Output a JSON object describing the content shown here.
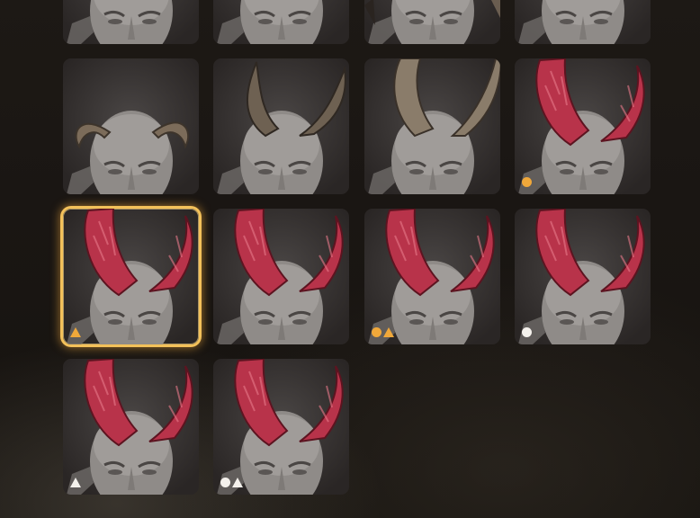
{
  "colors": {
    "selected_border": "#f3c15a",
    "badge_gold": "#f0a83a",
    "badge_white": "#f4f1ec",
    "horn_natural": "#7c6c5a",
    "horn_red": "#b8334a"
  },
  "tiles": [
    {
      "row": 0,
      "col": 0,
      "horn": "cropped",
      "badges": []
    },
    {
      "row": 0,
      "col": 1,
      "horn": "cropped",
      "badges": []
    },
    {
      "row": 0,
      "col": 2,
      "horn": "cropped-dark",
      "badges": []
    },
    {
      "row": 0,
      "col": 3,
      "horn": "cropped",
      "badges": []
    },
    {
      "row": 1,
      "col": 0,
      "horn": "ram-curled",
      "badges": []
    },
    {
      "row": 1,
      "col": 1,
      "horn": "tall-curved",
      "badges": []
    },
    {
      "row": 1,
      "col": 2,
      "horn": "tall-ridged",
      "badges": []
    },
    {
      "row": 1,
      "col": 3,
      "horn": "red-crystal",
      "badges": [
        "dot-gold"
      ]
    },
    {
      "row": 2,
      "col": 0,
      "horn": "red-crystal",
      "badges": [
        "tri-gold"
      ],
      "selected": true
    },
    {
      "row": 2,
      "col": 1,
      "horn": "red-crystal",
      "badges": []
    },
    {
      "row": 2,
      "col": 2,
      "horn": "red-crystal",
      "badges": [
        "dot-gold",
        "tri-gold"
      ]
    },
    {
      "row": 2,
      "col": 3,
      "horn": "red-crystal",
      "badges": [
        "dot-white"
      ]
    },
    {
      "row": 3,
      "col": 0,
      "horn": "red-crystal",
      "badges": [
        "tri-white"
      ]
    },
    {
      "row": 3,
      "col": 1,
      "horn": "red-crystal",
      "badges": [
        "dot-white",
        "tri-white"
      ]
    }
  ]
}
